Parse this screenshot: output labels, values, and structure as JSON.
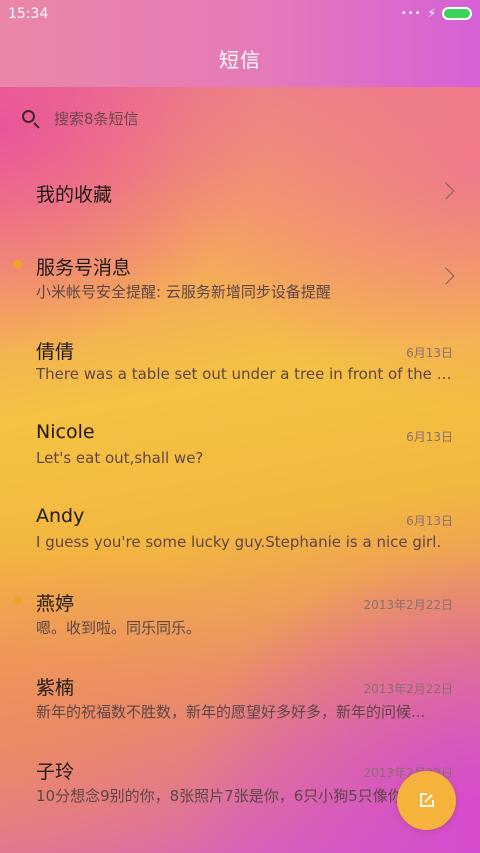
{
  "status_bar": {
    "time": "15:34",
    "signal_dots": "•••",
    "charging_icon": "⚡",
    "battery_color": "#3dd35a"
  },
  "header": {
    "title": "短信"
  },
  "search": {
    "placeholder": "搜索8条短信"
  },
  "favorites": {
    "label": "我的收藏"
  },
  "service": {
    "name": "服务号消息",
    "preview": "小米帐号安全提醒: 云服务新增同步设备提醒",
    "unread": true
  },
  "conversations": [
    {
      "name": "倩倩",
      "preview": "There was a table set out under a tree in front of the ho...",
      "date": "6月13日",
      "unread": false
    },
    {
      "name": "Nicole",
      "preview": "Let's eat out,shall we?",
      "date": "6月13日",
      "unread": false
    },
    {
      "name": "Andy",
      "preview": "I guess you're some lucky guy.Stephanie is a nice girl.",
      "date": "6月13日",
      "unread": false
    },
    {
      "name": "燕婷",
      "preview": "嗯。收到啦。同乐同乐。",
      "date": "2013年2月22日",
      "unread": true
    },
    {
      "name": "紫楠",
      "preview": "新年的祝福数不胜数，新年的愿望好多好多，新年的问候...",
      "date": "2013年2月22日",
      "unread": false
    },
    {
      "name": "子玲",
      "preview": "10分想念9别的你，8张照片7张是你，6只小狗5只像你...",
      "date": "2013年2月22日",
      "unread": false
    }
  ],
  "compose_button": {
    "icon": "compose-icon",
    "color": "#f6b33b"
  }
}
